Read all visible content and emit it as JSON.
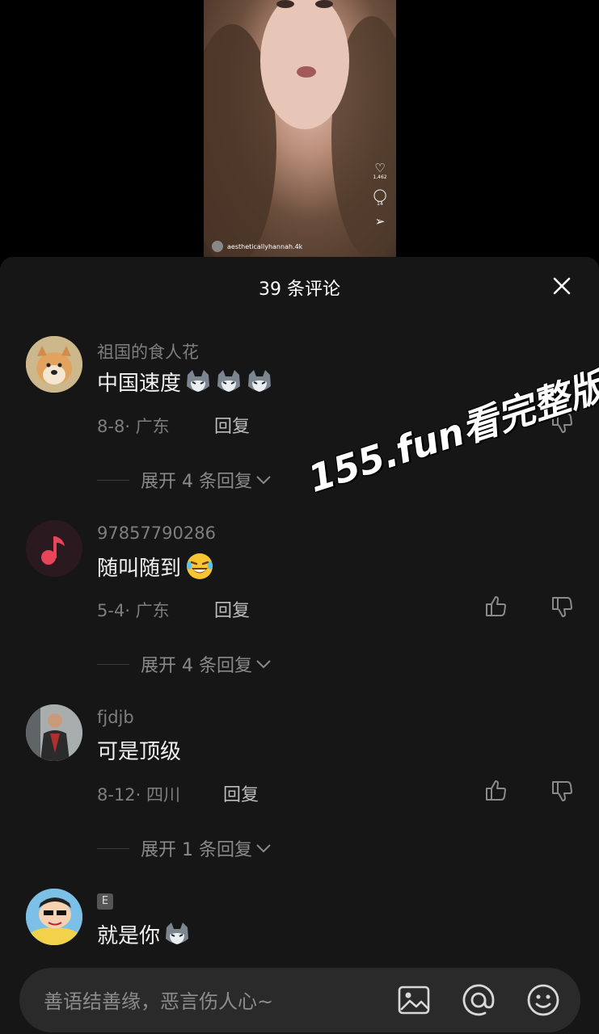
{
  "video": {
    "likes": "1,462",
    "comments": "14",
    "handle": "aestheticallyhannah.4k"
  },
  "sheet": {
    "title": "39 条评论"
  },
  "comments": [
    {
      "user": "祖国的食人花",
      "text": "中国速度",
      "date": "8-8",
      "location": "广东",
      "reply_label": "回复",
      "expand": "展开 4 条回复"
    },
    {
      "user": "97857790286",
      "text": "随叫随到",
      "date": "5-4",
      "location": "广东",
      "reply_label": "回复",
      "expand": "展开 4 条回复"
    },
    {
      "user": "fjdjb",
      "text": "可是顶级",
      "date": "8-12",
      "location": "四川",
      "reply_label": "回复",
      "expand": "展开 1 条回复"
    },
    {
      "badge": "E",
      "text": "就是你"
    }
  ],
  "watermark": "155.fun看完整版",
  "input": {
    "placeholder": "善语结善缘，恶言伤人心~"
  },
  "icons": [
    "heart-icon",
    "comment-icon",
    "share-icon",
    "close-icon",
    "thumbs-up-icon",
    "thumbs-down-icon",
    "chevron-down-icon",
    "image-icon",
    "at-icon",
    "emoji-icon"
  ]
}
